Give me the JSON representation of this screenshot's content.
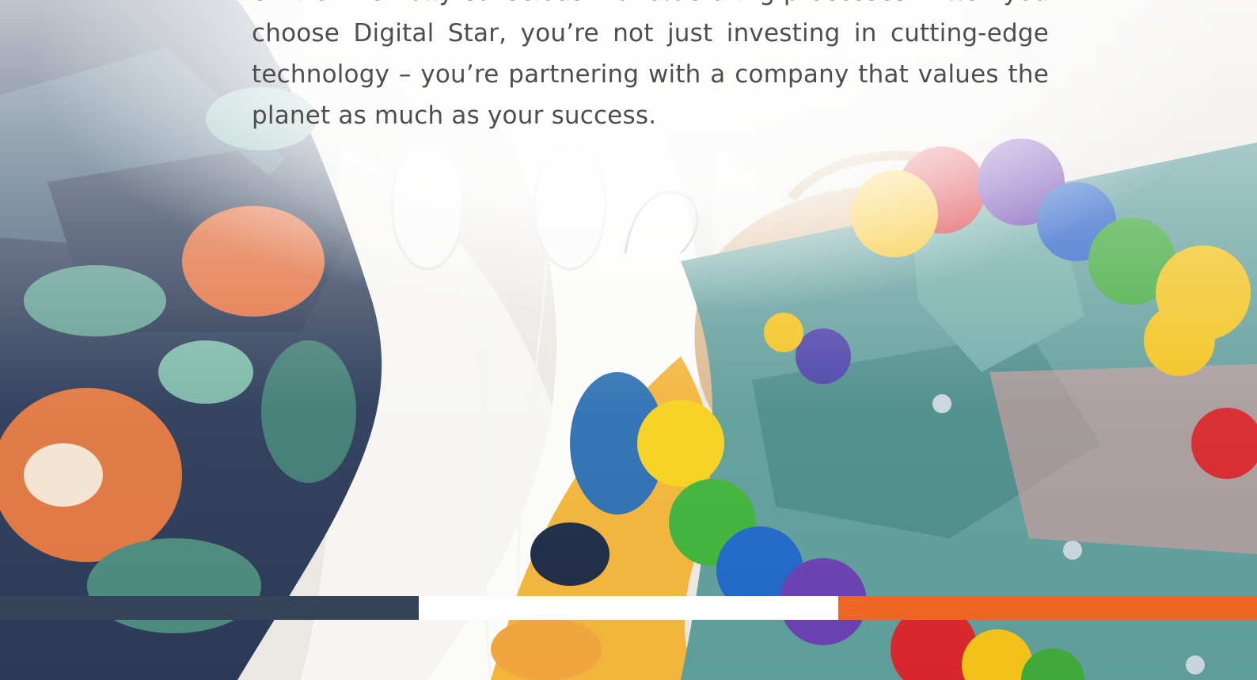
{
  "content": {
    "paragraph": "environmentally conscious manufacturing processes. When you choose Digital Star, you’re not just investing in cutting-edge technology – you’re partnering with a company that values the planet as much as your success.",
    "background_image": "tropical shirts and headphones on white fabric"
  },
  "stripe": {
    "colors": [
      "#34425a",
      "#ffffff",
      "#ef6523"
    ]
  },
  "icons": [
    "photo-background"
  ]
}
